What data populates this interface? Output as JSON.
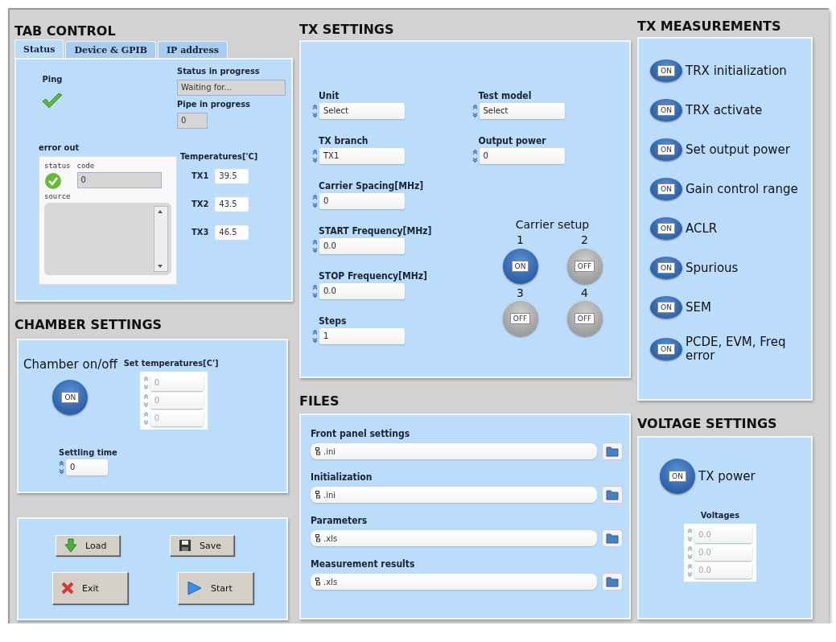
{
  "tab_control": {
    "title": "TAB CONTROL",
    "tabs": [
      {
        "label": "Status",
        "selected": true
      },
      {
        "label": "Device & GPIB",
        "selected": false
      },
      {
        "label": "IP address",
        "selected": false
      }
    ],
    "ping": {
      "label": "Ping",
      "ok": true
    },
    "status_in_progress": {
      "label": "Status in progress",
      "value": "Waiting for..."
    },
    "pipe_in_progress": {
      "label": "Pipe in progress",
      "value": "0"
    },
    "error_out": {
      "label": "error out",
      "status_label": "status",
      "status_ok": true,
      "code_label": "code",
      "code_value": "0",
      "source_label": "source"
    },
    "temperatures": {
      "label": "Temperatures['C]",
      "items": [
        {
          "name": "TX1",
          "value": "39.5"
        },
        {
          "name": "TX2",
          "value": "43.5"
        },
        {
          "name": "TX3",
          "value": "46.5"
        }
      ]
    }
  },
  "chamber_settings": {
    "title": "CHAMBER SETTINGS",
    "chamber_toggle": {
      "label": "Chamber on/off",
      "switch_text": "ON",
      "on": true
    },
    "set_temperatures": {
      "label": "Set temperatures[C']",
      "values": [
        "0",
        "0",
        "0"
      ]
    },
    "settling_time": {
      "label": "Settling time",
      "value": "0"
    }
  },
  "buttons": [
    {
      "label": "Load",
      "kind": "load"
    },
    {
      "label": "Save",
      "kind": "save"
    },
    {
      "label": "Exit",
      "kind": "exit"
    },
    {
      "label": "Start",
      "kind": "start"
    }
  ],
  "tx_settings": {
    "title": "TX SETTINGS",
    "left_fields": [
      {
        "label": "Unit",
        "value": "Select"
      },
      {
        "label": "TX branch",
        "value": "TX1"
      },
      {
        "label": "Carrier Spacing[MHz]",
        "value": "0"
      },
      {
        "label": "START Frequency[MHz]",
        "value": "0.0"
      },
      {
        "label": "STOP Frequency[MHz]",
        "value": "0.0"
      },
      {
        "label": "Steps",
        "value": "1"
      }
    ],
    "right_fields": [
      {
        "label": "Test model",
        "value": "Select"
      },
      {
        "label": "Output power",
        "value": "0"
      }
    ],
    "carrier_setup": {
      "label": "Carrier setup",
      "carriers": [
        {
          "number": "1",
          "switch_text": "ON",
          "on": true
        },
        {
          "number": "2",
          "switch_text": "OFF",
          "on": false
        },
        {
          "number": "3",
          "switch_text": "OFF",
          "on": false
        },
        {
          "number": "4",
          "switch_text": "OFF",
          "on": false
        }
      ]
    }
  },
  "files": {
    "title": "FILES",
    "items": [
      {
        "label": "Front panel settings",
        "value": ".ini"
      },
      {
        "label": "Initialization",
        "value": ".ini"
      },
      {
        "label": "Parameters",
        "value": ".xls"
      },
      {
        "label": "Measurement results",
        "value": ".xls"
      }
    ]
  },
  "tx_measurements": {
    "title": "TX MEASUREMENTS",
    "items": [
      {
        "label": "TRX initialization",
        "switch_text": "ON",
        "on": true
      },
      {
        "label": "TRX activate",
        "switch_text": "ON",
        "on": true
      },
      {
        "label": "Set output power",
        "switch_text": "ON",
        "on": true
      },
      {
        "label": "Gain control range",
        "switch_text": "ON",
        "on": true
      },
      {
        "label": "ACLR",
        "switch_text": "ON",
        "on": true
      },
      {
        "label": "Spurious",
        "switch_text": "ON",
        "on": true
      },
      {
        "label": "SEM",
        "switch_text": "ON",
        "on": true
      },
      {
        "label": "PCDE, EVM, Freq error",
        "switch_text": "ON",
        "on": true
      }
    ]
  },
  "voltage_settings": {
    "title": "VOLTAGE SETTINGS",
    "tx_power": {
      "label": "TX power",
      "switch_text": "ON",
      "on": true
    },
    "voltages": {
      "label": "Voltages",
      "values": [
        "0.0",
        "0.0",
        "0.0"
      ]
    }
  }
}
